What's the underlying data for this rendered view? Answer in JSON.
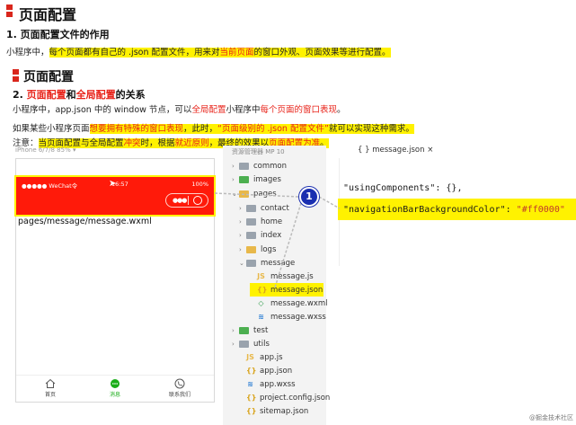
{
  "title": "页面配置",
  "subtitle": "1. 页面配置文件的作用",
  "intro": {
    "a": "小程序中，",
    "b": "每个页面都有自己的 .json 配置文件，用来对",
    "c": "当前页面",
    "d": "的窗口外观、页面效果等进行配置。"
  },
  "title2": "页面配置",
  "subtitle2": {
    "a": "2. ",
    "b": "页面配置",
    "c": "和",
    "d": "全局配置",
    "e": "的关系"
  },
  "p2": {
    "a": "小程序中，app.json 中的 window 节点，可以",
    "b": "全局配置",
    "c": "小程序中",
    "d": "每个页面的窗口表现",
    "e": "。"
  },
  "p3": {
    "a": "如果某些小程序页面",
    "b": "想要拥有特殊的窗口表现",
    "c": "，此时，",
    "d": "“页面级别的 .json 配置文件”",
    "e": "就可以实现这种需求。"
  },
  "p4": {
    "a": "注意：",
    "b": "当页面配置与全局配置",
    "c": "冲突",
    "d": "时，根据",
    "e": "就近原则",
    "f": "，最终的效果以",
    "g": "页面配置为准",
    "h": "。"
  },
  "simulator": {
    "device": "iPhone 6/7/8 85% ▾",
    "status_left": "●●●●● WeChat令",
    "status_time": "16:57",
    "status_right": "100%",
    "page_path": "pages/message/message.wxml",
    "tabs": [
      "首页",
      "消息",
      "联系我们"
    ]
  },
  "explorer": {
    "title": "资源管理器  MP  10",
    "items": [
      {
        "label": "common",
        "icon": "folder-gray"
      },
      {
        "label": "images",
        "icon": "folder-green"
      },
      {
        "label": "pages",
        "icon": "folder-yellow"
      },
      {
        "label": "contact",
        "icon": "folder-gray"
      },
      {
        "label": "home",
        "icon": "folder-gray"
      },
      {
        "label": "index",
        "icon": "folder-gray"
      },
      {
        "label": "logs",
        "icon": "folder-yellow"
      },
      {
        "label": "message",
        "icon": "folder-gray"
      },
      {
        "label": "message.js",
        "icon": "js-file"
      },
      {
        "label": "message.json",
        "icon": "json-file"
      },
      {
        "label": "message.wxml",
        "icon": "wxml-file"
      },
      {
        "label": "message.wxss",
        "icon": "wxss-file"
      },
      {
        "label": "test",
        "icon": "folder-green"
      },
      {
        "label": "utils",
        "icon": "folder-gray"
      },
      {
        "label": "app.js",
        "icon": "js-file"
      },
      {
        "label": "app.json",
        "icon": "json-file"
      },
      {
        "label": "app.wxss",
        "icon": "wxss-file"
      },
      {
        "label": "project.config.json",
        "icon": "json-file"
      },
      {
        "label": "sitemap.json",
        "icon": "json-file"
      }
    ]
  },
  "editor": {
    "tab": "{ } message.json ×",
    "line1_key": "\"usingComponents\"",
    "line1_rest": ": {},",
    "line2_key": "\"navigationBarBackgroundColor\"",
    "line2_colon": ": ",
    "line2_val": "\"#ff0000\""
  },
  "callout": "1",
  "watermark": "@掘金技术社区",
  "colors": {
    "accent": "#ff1a0a",
    "highlight": "#fff200",
    "callout": "#1a2fb0"
  }
}
